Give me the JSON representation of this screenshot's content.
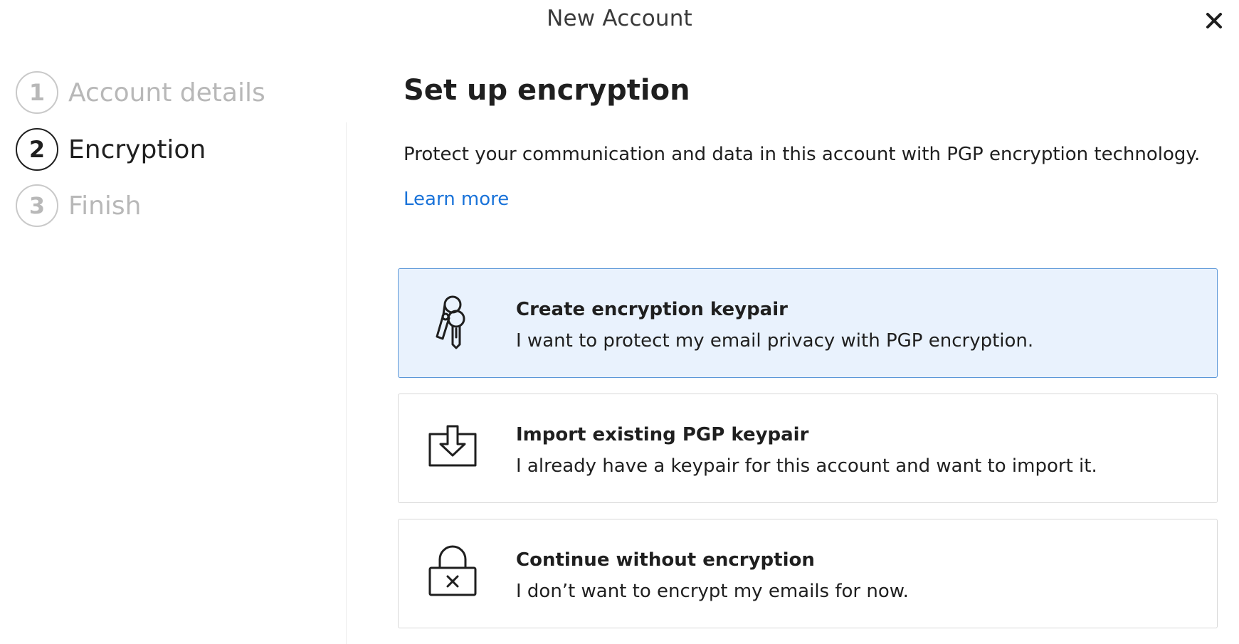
{
  "window": {
    "title": "New Account",
    "close_icon": "close-icon"
  },
  "steps": [
    {
      "number": "1",
      "label": "Account details",
      "state": "inactive"
    },
    {
      "number": "2",
      "label": "Encryption",
      "state": "active"
    },
    {
      "number": "3",
      "label": "Finish",
      "state": "inactive"
    }
  ],
  "main": {
    "title": "Set up encryption",
    "description": "Protect your communication and data in this account with PGP encryption technology.",
    "learn_more": "Learn more",
    "options": [
      {
        "title": "Create encryption keypair",
        "subtitle": "I want to protect my email privacy with PGP encryption.",
        "icon": "keys-icon",
        "selected": true
      },
      {
        "title": "Import existing PGP keypair",
        "subtitle": "I already have a keypair for this account and want to import it.",
        "icon": "import-icon",
        "selected": false
      },
      {
        "title": "Continue without encryption",
        "subtitle": "I don’t want to encrypt my emails for now.",
        "icon": "unlock-cancel-icon",
        "selected": false
      }
    ]
  },
  "colors": {
    "accent_link": "#1a73d9",
    "selected_card_bg": "#e9f2fd",
    "selected_card_border": "#5b97d8",
    "inactive_text": "#b8b8b8"
  }
}
